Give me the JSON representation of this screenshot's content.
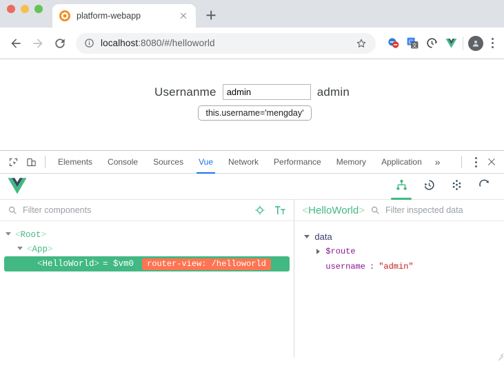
{
  "browser": {
    "window_controls": [
      "close",
      "minimize",
      "maximize"
    ],
    "tab": {
      "title": "platform-webapp",
      "favicon_name": "orange-asterisk-favicon",
      "close_label": "×"
    },
    "new_tab_label": "+",
    "nav": {
      "back_label": "Back",
      "forward_label": "Forward",
      "reload_label": "Reload"
    },
    "omnibox": {
      "site_info_label": "View site information",
      "url_host": "localhost",
      "url_rest": ":8080/#/helloworld",
      "full_url": "localhost:8080/#/helloworld",
      "bookmark_label": "Bookmark this tab"
    },
    "extensions": [
      {
        "name": "adblock-extension-icon",
        "title": "AdBlock"
      },
      {
        "name": "google-translate-extension-icon",
        "title": "Google Translate"
      },
      {
        "name": "sync-extension-icon",
        "title": "Tampermonkey"
      },
      {
        "name": "vue-devtools-extension-icon",
        "title": "Vue.js devtools"
      }
    ],
    "profile_label": "Profile",
    "menu_label": "Customize and control Google Chrome"
  },
  "page": {
    "username_label": "Usernanme",
    "username_value": "admin",
    "username_placeholder": "",
    "username_echo": "admin",
    "set_button_label": "this.username='mengday'"
  },
  "devtools": {
    "tools": {
      "inspect_label": "Inspect element",
      "device_toolbar_label": "Toggle device toolbar"
    },
    "tabs": [
      {
        "label": "Elements",
        "active": false
      },
      {
        "label": "Console",
        "active": false
      },
      {
        "label": "Sources",
        "active": false
      },
      {
        "label": "Vue",
        "active": true
      },
      {
        "label": "Network",
        "active": false
      },
      {
        "label": "Performance",
        "active": false
      },
      {
        "label": "Memory",
        "active": false
      },
      {
        "label": "Application",
        "active": false
      }
    ],
    "overflow_label": "»",
    "settings_label": "More options",
    "close_label": "Close DevTools",
    "accent_color": "#1a73e8"
  },
  "vue_panel": {
    "logo_name": "vue-logo",
    "brand_color": "#42b883",
    "actions": [
      {
        "name": "component-tree-icon",
        "label": "Components",
        "active": true
      },
      {
        "name": "timeline-icon",
        "label": "Timeline",
        "active": false
      },
      {
        "name": "vuex-icon",
        "label": "Vuex",
        "active": false
      },
      {
        "name": "refresh-icon",
        "label": "Refresh",
        "active": false
      }
    ],
    "components": {
      "filter_placeholder": "Filter components",
      "filter_value": "",
      "select_label": "Select component in the page",
      "text_size_label": "Toggle text size",
      "tree": [
        {
          "tag": "Root",
          "depth": 0,
          "expanded": true,
          "selected": false,
          "vm": "",
          "badge": ""
        },
        {
          "tag": "App",
          "depth": 1,
          "expanded": true,
          "selected": false,
          "vm": "",
          "badge": ""
        },
        {
          "tag": "HelloWorld",
          "depth": 2,
          "expanded": false,
          "selected": true,
          "vm": "= $vm0",
          "badge": "router-view: /helloworld"
        }
      ]
    },
    "inspector": {
      "title": "HelloWorld",
      "filter_placeholder": "Filter inspected data",
      "filter_value": "",
      "sections": [
        {
          "name": "data",
          "expanded": true,
          "entries": [
            {
              "key": "$route",
              "value": "",
              "collapsible": true,
              "expanded": false
            },
            {
              "key": "username",
              "value": "\"admin\"",
              "collapsible": false,
              "expanded": false
            }
          ]
        }
      ]
    }
  }
}
